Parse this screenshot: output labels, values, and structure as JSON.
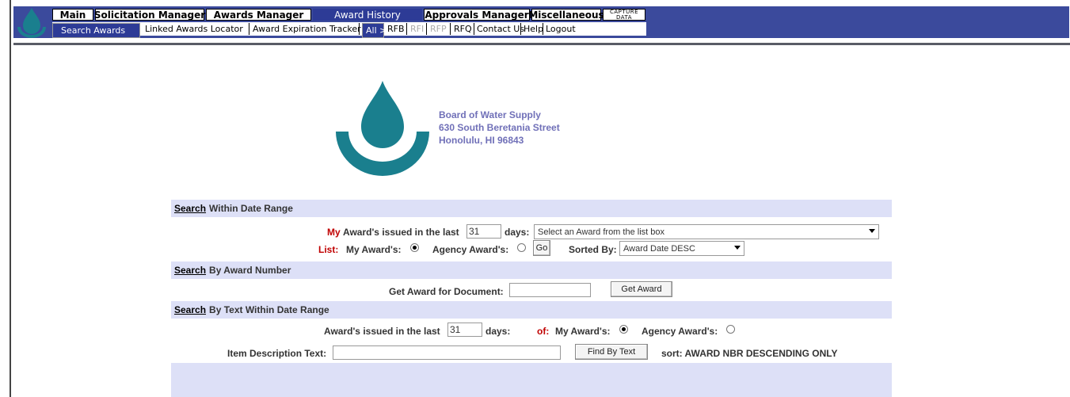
{
  "nav": {
    "tabs": [
      {
        "label": "Main"
      },
      {
        "label": "Solicitation Manager"
      },
      {
        "label": "Awards Manager"
      },
      {
        "label": "Award History"
      },
      {
        "label": "Approvals Manager"
      },
      {
        "label": "Miscellaneous"
      }
    ],
    "capture_line1": "CAPTURE",
    "capture_line2": "DATA",
    "subnav": [
      "Search Awards",
      "Linked Awards Locator",
      "Award Expiration Tracker",
      "All >",
      "RFB",
      "RFI",
      "RFP",
      "RFQ",
      "Contact Us",
      "Help",
      "Logout"
    ]
  },
  "org": {
    "name": "Board of Water Supply",
    "street": "630 South Beretania Street",
    "city": "Honolulu, HI 96843"
  },
  "date_search": {
    "header_link": "Search",
    "header_text": "Within Date Range",
    "my_prefix": "My",
    "issued_label": "Award's issued in the last",
    "days_value": "31",
    "days_label": "days:",
    "award_select": "Select an Award from the list box",
    "list_label": "List:",
    "my_awards_label": "My Award's:",
    "agency_awards_label": "Agency Award's:",
    "go_label": "Go",
    "sorted_label": "Sorted By:",
    "sort_value": "Award Date DESC"
  },
  "number_search": {
    "header_link": "Search",
    "header_text": "By Award Number",
    "doc_label": "Get Award for Document:",
    "doc_value": "",
    "button": "Get Award"
  },
  "text_search": {
    "header_link": "Search",
    "header_text": "By Text Within Date Range",
    "issued_label": "Award's issued in the last",
    "days_value": "31",
    "days_label": "days:",
    "of_label": "of:",
    "my_awards_label": "My Award's:",
    "agency_awards_label": "Agency Award's:",
    "item_label": "Item Description Text:",
    "item_value": "",
    "button": "Find By Text",
    "sort_note": "sort: AWARD NBR DESCENDING ONLY"
  },
  "colors": {
    "brand": "#1a7f8e",
    "banner": "#3b4a9c",
    "panel": "#dde0f7"
  }
}
